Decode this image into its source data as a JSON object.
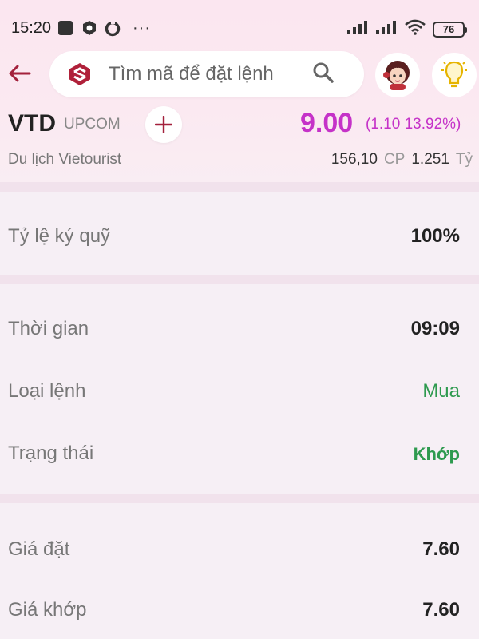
{
  "status_bar": {
    "time": "15:20",
    "dots": "···",
    "battery": "76",
    "icons": [
      "square-icon",
      "shield-app-icon",
      "sync-app-icon",
      "cell-signal-icon",
      "cell-signal-icon",
      "wifi-icon",
      "battery-icon"
    ]
  },
  "header": {
    "search_placeholder": "Tìm mã để đặt lệnh",
    "icons": [
      "back-arrow-icon",
      "brand-logo-icon",
      "search-icon",
      "assistant-avatar-icon",
      "lightbulb-icon"
    ]
  },
  "stock": {
    "ticker": "VTD",
    "exchange": "UPCOM",
    "price": "9.00",
    "change": "(1.10 13.92%)",
    "company": "Du lịch Vietourist",
    "volume": "156,10",
    "volume_unit": "CP",
    "value": "1.251",
    "value_unit": "Tỷ"
  },
  "details": {
    "margin": {
      "label": "Tỷ lệ ký quỹ",
      "value": "100%"
    },
    "time": {
      "label": "Thời gian",
      "value": "09:09"
    },
    "order_type": {
      "label": "Loại lệnh",
      "value": "Mua"
    },
    "status": {
      "label": "Trạng thái",
      "value": "Khớp"
    },
    "order_price": {
      "label": "Giá đặt",
      "value": "7.60"
    },
    "matched_price": {
      "label": "Giá khớp",
      "value": "7.60"
    }
  },
  "colors": {
    "accent": "#c532c8",
    "positive": "#2e9a4f",
    "brand": "#b0213a"
  }
}
